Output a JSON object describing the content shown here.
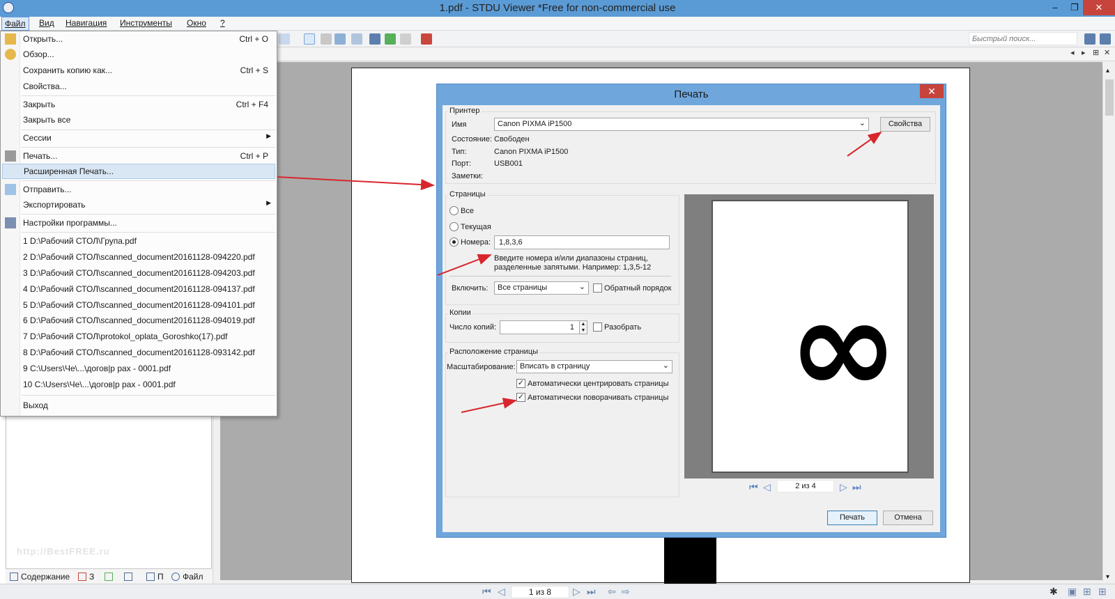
{
  "window": {
    "title": "1.pdf - STDU Viewer *Free for non-commercial use",
    "minimize": "–",
    "restore": "❐",
    "close": "✕"
  },
  "menubar": [
    "Файл",
    "Вид",
    "Навигация",
    "Инструменты",
    "Окно",
    "?"
  ],
  "quick_search": {
    "placeholder": "Быстрый поиск..."
  },
  "file_menu": {
    "items": [
      {
        "label": "Открыть...",
        "shortcut": "Ctrl + O",
        "icon": "folder-open-icon"
      },
      {
        "label": "Обзор...",
        "shortcut": "",
        "icon": "browse-icon"
      },
      {
        "label": "Сохранить копию как...",
        "shortcut": "Ctrl + S",
        "icon": ""
      },
      {
        "label": "Свойства...",
        "shortcut": "",
        "icon": ""
      },
      {
        "label": "Закрыть",
        "shortcut": "Ctrl + F4",
        "icon": ""
      },
      {
        "label": "Закрыть все",
        "shortcut": "",
        "icon": ""
      },
      {
        "label": "Сессии",
        "shortcut": "",
        "icon": ""
      },
      {
        "label": "Печать...",
        "shortcut": "Ctrl + P",
        "icon": "printer-icon"
      },
      {
        "label": "Расширенная Печать...",
        "shortcut": "",
        "icon": ""
      },
      {
        "label": "Отправить...",
        "shortcut": "",
        "icon": "mail-icon"
      },
      {
        "label": "Экспортировать",
        "shortcut": "",
        "icon": ""
      },
      {
        "label": "Настройки программы...",
        "shortcut": "",
        "icon": "settings-icon"
      }
    ],
    "recent": [
      "1 D:\\Рабочий СТОЛ\\Група.pdf",
      "2 D:\\Рабочий СТОЛ\\scanned_document20161128-094220.pdf",
      "3 D:\\Рабочий СТОЛ\\scanned_document20161128-094203.pdf",
      "4 D:\\Рабочий СТОЛ\\scanned_document20161128-094137.pdf",
      "5 D:\\Рабочий СТОЛ\\scanned_document20161128-094101.pdf",
      "6 D:\\Рабочий СТОЛ\\scanned_document20161128-094019.pdf",
      "7 D:\\Рабочий СТОЛ\\protokol_oplata_Goroshko(17).pdf",
      "8 D:\\Рабочий СТОЛ\\scanned_document20161128-093142.pdf",
      "9 C:\\Users\\Че\\...\\догов|р рах - 0001.pdf",
      "10 C:\\Users\\Че\\...\\догов|р рах - 0001.pdf"
    ],
    "exit": "Выход"
  },
  "print_dialog": {
    "title": "Печать",
    "close": "✕",
    "printer": {
      "group": "Принтер",
      "name_label": "Имя",
      "name_value": "Canon PIXMA iP1500",
      "properties_button": "Свойства",
      "status_label": "Состояние:",
      "status_value": "Свободен",
      "type_label": "Тип:",
      "type_value": "Canon PIXMA iP1500",
      "port_label": "Порт:",
      "port_value": "USB001",
      "notes_label": "Заметки:"
    },
    "pages": {
      "group": "Страницы",
      "all": "Все",
      "current": "Текущая",
      "numbers": "Номера:",
      "numbers_value": "1,8,3,6",
      "hint_line1": "Введите номера и/или диапазоны страниц,",
      "hint_line2": "разделенные запятыми. Например: 1,3,5-12",
      "include_label": "Включить:",
      "include_value": "Все страницы",
      "reverse_label": "Обратный порядок"
    },
    "copies": {
      "group": "Копии",
      "count_label": "Число копий:",
      "count_value": "1",
      "collate_label": "Разобрать"
    },
    "layout": {
      "group": "Расположение страницы",
      "scale_label": "Масштабирование:",
      "scale_value": "Вписать в страницу",
      "auto_center": "Автоматически центрировать страницы",
      "auto_rotate": "Автоматически поворачивать страницы"
    },
    "preview": {
      "page_indicator": "2 из 4",
      "glyph": "∞"
    },
    "buttons": {
      "print": "Печать",
      "cancel": "Отмена"
    }
  },
  "left_panel": {
    "watermark": "http://BestFREE.ru",
    "tabs": [
      "Содержание",
      "З",
      "",
      "",
      "П",
      "Файл"
    ]
  },
  "statusbar": {
    "page_indicator": "1 из 8"
  },
  "colors": {
    "titlebar": "#5b9bd5",
    "highlight": "#d9e7f5",
    "close": "#c7443d",
    "arrow": "#d8262c"
  }
}
